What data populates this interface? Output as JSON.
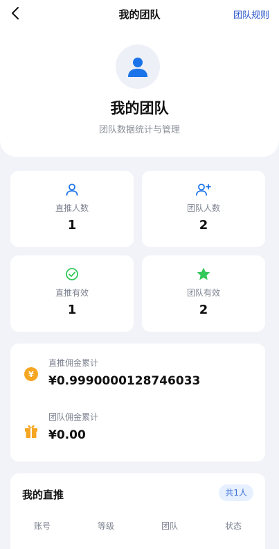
{
  "nav": {
    "title": "我的团队",
    "rules": "团队规则"
  },
  "hero": {
    "title": "我的团队",
    "subtitle": "团队数据统计与管理"
  },
  "stats": [
    {
      "label": "直推人数",
      "value": "1",
      "icon": "user-icon"
    },
    {
      "label": "团队人数",
      "value": "2",
      "icon": "user-plus-icon"
    },
    {
      "label": "直推有效",
      "value": "1",
      "icon": "check-circle-icon"
    },
    {
      "label": "团队有效",
      "value": "2",
      "icon": "star-icon"
    }
  ],
  "commission": {
    "direct_label": "直推佣金累计",
    "direct_value": "¥0.9990000128746033",
    "direct_icon_glyph": "¥",
    "team_label": "团队佣金累计",
    "team_value": "¥0.00"
  },
  "direct_list": {
    "title": "我的直推",
    "count_badge": "共1人",
    "columns": [
      "账号",
      "等级",
      "团队",
      "状态"
    ]
  },
  "colors": {
    "primary_blue": "#1a73e8",
    "link_blue": "#2b56c9",
    "green": "#34c759",
    "orange": "#f5a623"
  }
}
